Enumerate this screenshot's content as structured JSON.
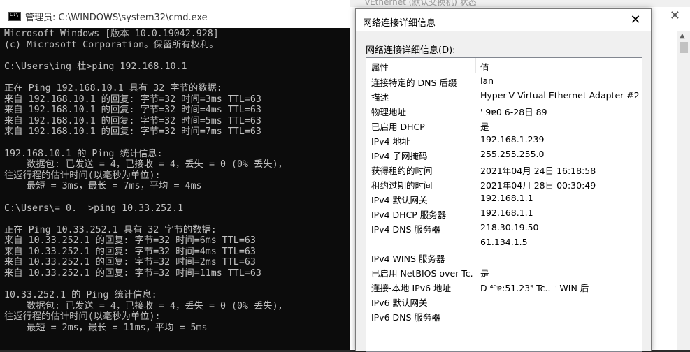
{
  "background_window": {
    "title_fragment": "vEthernet (默认交换机) 状态"
  },
  "cmd": {
    "title": "管理员: C:\\WINDOWS\\system32\\cmd.exe",
    "lines": [
      "Microsoft Windows [版本 10.0.19042.928]",
      "(c) Microsoft Corporation。保留所有权利。",
      "",
      "C:\\Users\\ing 杜>ping 192.168.10.1",
      "",
      "正在 Ping 192.168.10.1 具有 32 字节的数据:",
      "来自 192.168.10.1 的回复: 字节=32 时间=3ms TTL=63",
      "来自 192.168.10.1 的回复: 字节=32 时间=4ms TTL=63",
      "来自 192.168.10.1 的回复: 字节=32 时间=5ms TTL=63",
      "来自 192.168.10.1 的回复: 字节=32 时间=7ms TTL=63",
      "",
      "192.168.10.1 的 Ping 统计信息:",
      "    数据包: 已发送 = 4，已接收 = 4，丢失 = 0 (0% 丢失)，",
      "往返行程的估计时间(以毫秒为单位):",
      "    最短 = 3ms，最长 = 7ms，平均 = 4ms",
      "",
      "C:\\Users\\= 0.  >ping 10.33.252.1",
      "",
      "正在 Ping 10.33.252.1 具有 32 字节的数据:",
      "来自 10.33.252.1 的回复: 字节=32 时间=6ms TTL=63",
      "来自 10.33.252.1 的回复: 字节=32 时间=4ms TTL=63",
      "来自 10.33.252.1 的回复: 字节=32 时间=2ms TTL=63",
      "来自 10.33.252.1 的回复: 字节=32 时间=11ms TTL=63",
      "",
      "10.33.252.1 的 Ping 统计信息:",
      "    数据包: 已发送 = 4，已接收 = 4，丢失 = 0 (0% 丢失)，",
      "往返行程的估计时间(以毫秒为单位):",
      "    最短 = 2ms，最长 = 11ms，平均 = 5ms"
    ]
  },
  "dialog": {
    "title": "网络连接详细信息",
    "close_glyph": "✕",
    "details_label": "网络连接详细信息(D):",
    "columns": {
      "property": "属性",
      "value": "值"
    },
    "rows": [
      {
        "property": "连接特定的 DNS 后缀",
        "value": "lan"
      },
      {
        "property": "描述",
        "value": "Hyper-V Virtual Ethernet Adapter #2"
      },
      {
        "property": "物理地址",
        "value": "' 9ɐ0 6-28日 89"
      },
      {
        "property": "已启用 DHCP",
        "value": "是"
      },
      {
        "property": "IPv4 地址",
        "value": "192.168.1.239"
      },
      {
        "property": "IPv4 子网掩码",
        "value": "255.255.255.0"
      },
      {
        "property": "获得租约的时间",
        "value": "2021年04月 24日 16:18:58"
      },
      {
        "property": "租约过期的时间",
        "value": "2021年04月 28日 00:30:49"
      },
      {
        "property": "IPv4 默认网关",
        "value": "192.168.1.1"
      },
      {
        "property": "IPv4 DHCP 服务器",
        "value": "192.168.1.1"
      },
      {
        "property": "IPv4 DNS 服务器",
        "value": "218.30.19.50"
      },
      {
        "property": "",
        "value": "61.134.1.5"
      },
      {
        "property": "IPv4 WINS 服务器",
        "value": ""
      },
      {
        "property": "已启用 NetBIOS over Tc...",
        "value": "是"
      },
      {
        "property": "连接-本地 IPv6 地址",
        "value": "D ⁴⁰ɐ:51.23⁹ Tc.. ʰ WIN 后"
      },
      {
        "property": "IPv6 默认网关",
        "value": ""
      },
      {
        "property": "IPv6 DNS 服务器",
        "value": ""
      }
    ]
  }
}
